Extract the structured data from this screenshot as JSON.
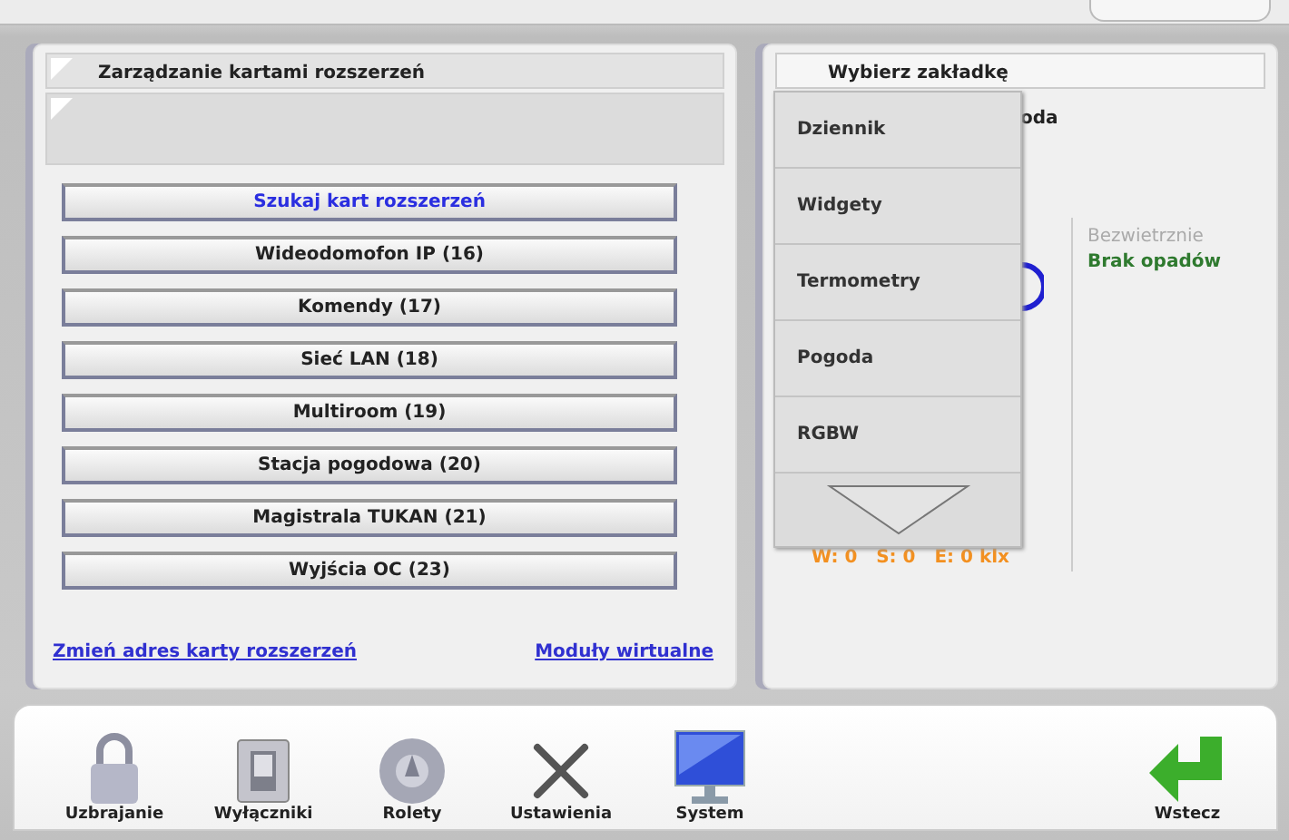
{
  "left_panel": {
    "title": "Zarządzanie kartami rozszerzeń",
    "buttons": [
      {
        "label": "Szukaj kart rozszerzeń",
        "kind": "search"
      },
      {
        "label": "Wideodomofon IP (16)",
        "kind": "card"
      },
      {
        "label": "Komendy (17)",
        "kind": "card"
      },
      {
        "label": "Sieć LAN (18)",
        "kind": "card"
      },
      {
        "label": "Multiroom (19)",
        "kind": "card"
      },
      {
        "label": "Stacja pogodowa (20)",
        "kind": "card"
      },
      {
        "label": "Magistrala TUKAN (21)",
        "kind": "card"
      },
      {
        "label": "Wyjścia OC (23)",
        "kind": "card"
      }
    ],
    "links": [
      "Zmień adres karty rozszerzeń",
      "Moduły wirtualne"
    ]
  },
  "right_panel": {
    "title": "Wybierz zakładkę",
    "heading_fragment": "oda",
    "wind": "Bezwietrznie",
    "rain": "Brak opadów",
    "light": "W: 0   S: 0   E: 0 klx",
    "dropdown": [
      "Dziennik",
      "Widgety",
      "Termometry",
      "Pogoda",
      "RGBW"
    ]
  },
  "toolbar": [
    {
      "label": "Uzbrajanie",
      "kind": "lock"
    },
    {
      "label": "Wyłączniki",
      "kind": "switch"
    },
    {
      "label": "Rolety",
      "kind": "blind"
    },
    {
      "label": "Ustawienia",
      "kind": "tools"
    },
    {
      "label": "System",
      "kind": "monitor"
    },
    {
      "label": "Wstecz",
      "kind": "back"
    }
  ]
}
